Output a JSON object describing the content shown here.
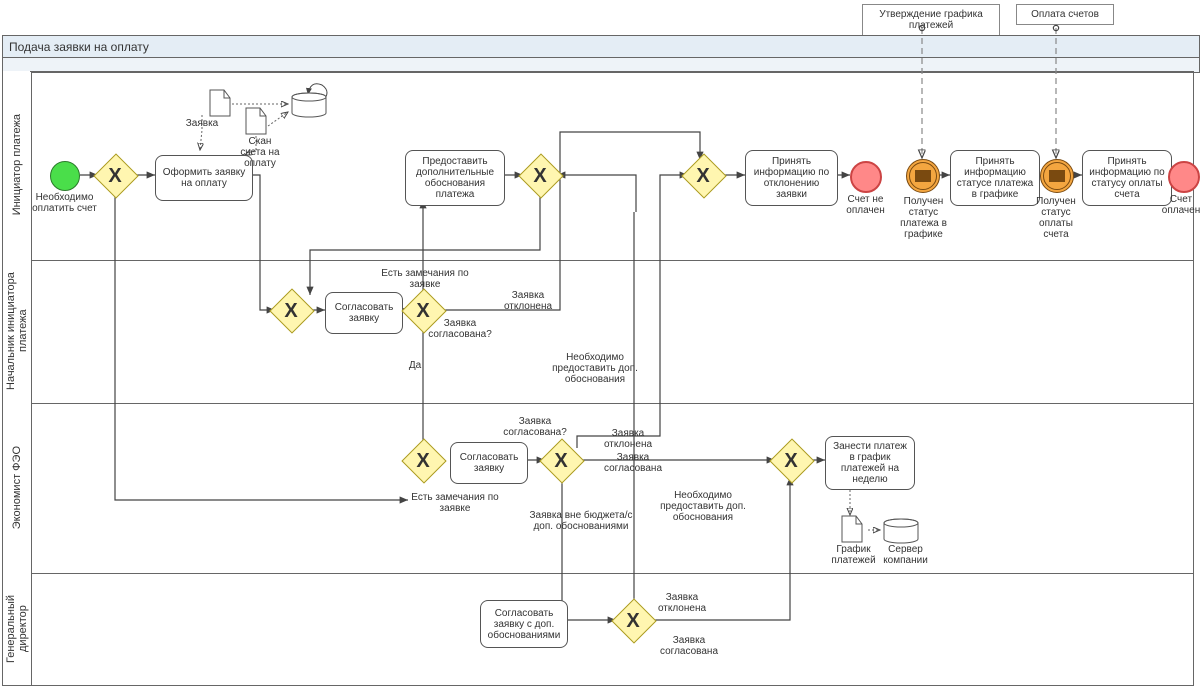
{
  "messages": {
    "approve_schedule": "Утверждение графика платежей",
    "pay_bills": "Оплата счетов"
  },
  "pool": {
    "title": "Подача заявки на оплату"
  },
  "lanes": {
    "initiator": "Инициатор платежа",
    "supervisor": "Начальник инициатора платежа",
    "economist": "Экономист ФЭО",
    "director": "Генеральный директор"
  },
  "events": {
    "start": "Необходимо оплатить счет",
    "end_not_paid": "Счет не оплачен",
    "msg_status_schedule": "Получен статус платежа в графике",
    "msg_status_pay": "Получен статус оплаты счета",
    "end_paid": "Счет оплачен"
  },
  "tasks": {
    "create_request": "Оформить заявку на оплату",
    "provide_justification": "Предоставить дополнительные обоснования платежа",
    "accept_rejection_info": "Принять информацию по отклонению заявки",
    "accept_status_schedule": "Принять информацию статусе платежа в графике",
    "accept_status_pay": "Принять информацию по статусу оплаты счета",
    "sup_approve": "Согласовать заявку",
    "eco_approve": "Согласовать заявку",
    "eco_enter_schedule": "Занести платеж в график платежей на неделю",
    "dir_approve": "Согласовать заявку с доп. обоснованиями"
  },
  "artifacts": {
    "request_doc": "Заявка",
    "scan_doc": "Скан счета на оплату",
    "schedule_doc": "График платежей",
    "company_server": "Сервер компании"
  },
  "labels": {
    "sup_has_remarks": "Есть замечания по заявке",
    "sup_rejected": "Заявка отклонена",
    "sup_approved_q": "Заявка согласована?",
    "sup_yes": "Да",
    "sup_need_justification": "Необходимо предоставить доп. обоснования",
    "eco_approved_q": "Заявка согласована?",
    "eco_rejected": "Заявка отклонена",
    "eco_approved": "Заявка согласована",
    "eco_has_remarks": "Есть замечания по заявке",
    "eco_out_budget": "Заявка вне бюджета/с доп. обоснованиями",
    "eco_need_justification": "Необходимо предоставить доп. обоснования",
    "dir_rejected": "Заявка отклонена",
    "dir_approved": "Заявка согласована"
  }
}
